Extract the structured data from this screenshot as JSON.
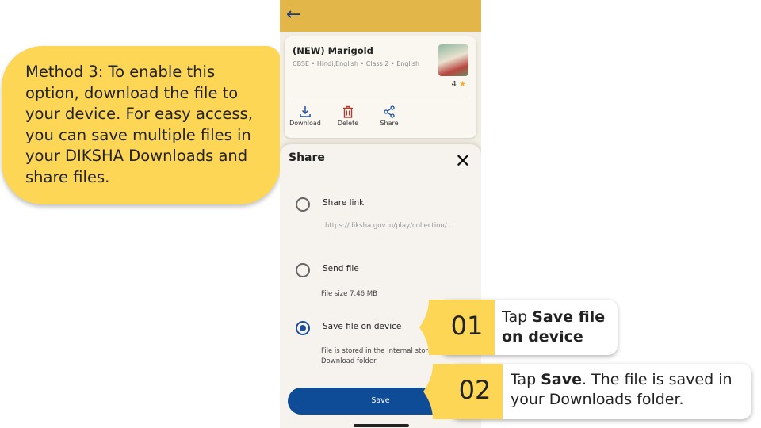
{
  "callout": {
    "text": "Method 3: To enable this option, download the file to your device. For easy access, you can save multiple files in your DIKSHA Downloads and share files."
  },
  "header": {
    "back_icon": "arrow-left-icon"
  },
  "card": {
    "title": "(NEW) Marigold",
    "meta": "CBSE  •  Hindi,English  •  Class 2  •  English",
    "rating": "4",
    "actions": [
      {
        "label": "Download",
        "icon": "download-icon"
      },
      {
        "label": "Delete",
        "icon": "trash-icon"
      },
      {
        "label": "Share",
        "icon": "share-icon"
      }
    ]
  },
  "sheet": {
    "title": "Share",
    "options": {
      "share_link": {
        "label": "Share link",
        "url": "https://diksha.gov.in/play/collection/...",
        "selected": false
      },
      "send_file": {
        "label": "Send file",
        "size": "File size 7.46 MB",
        "selected": false
      },
      "save_file": {
        "label": "Save file on device",
        "desc": "File is stored in the Internal storage, Download folder",
        "selected": true
      }
    },
    "save_button": "Save"
  },
  "steps": [
    {
      "number": "01",
      "text_pre": "Tap ",
      "text_bold": "Save file on device",
      "text_post": ""
    },
    {
      "number": "02",
      "text_pre": "Tap ",
      "text_bold": "Save",
      "text_post": ". The file is saved in your Downloads folder."
    }
  ],
  "colors": {
    "accent_yellow": "#FDD655",
    "header_gold": "#E3B64A",
    "primary_blue": "#0E4C97"
  }
}
